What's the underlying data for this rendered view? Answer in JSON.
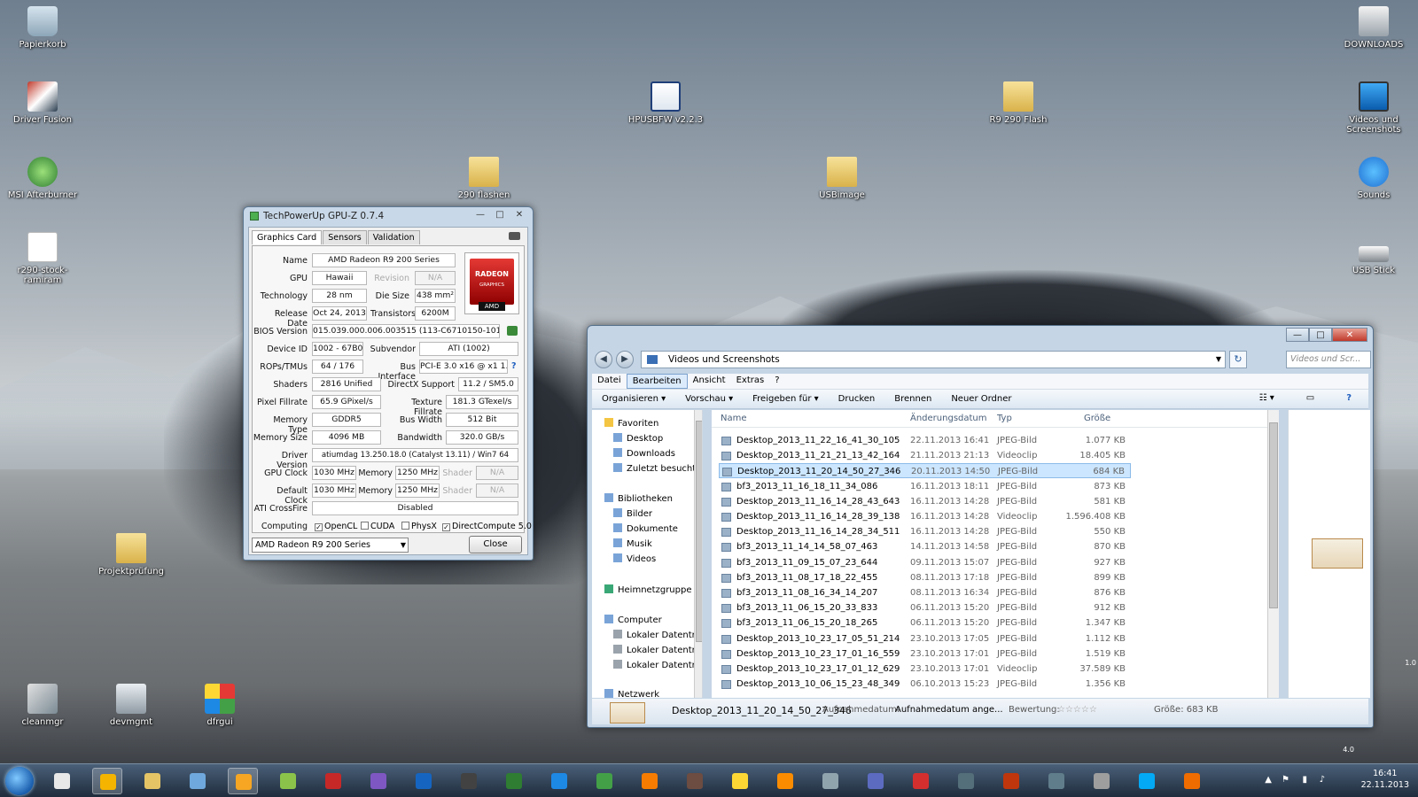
{
  "desktop": {
    "icons": [
      {
        "label": "Papierkorb",
        "icon": "recycle-bin-icon"
      },
      {
        "label": "Driver Fusion",
        "icon": "driver-fusion-icon"
      },
      {
        "label": "MSI Afterburner",
        "icon": "msi-afterburner-icon"
      },
      {
        "label": "r290-stock-ramiram",
        "icon": "document-icon"
      },
      {
        "label": "HPUSBFW v2.2.3",
        "icon": "window-app-icon"
      },
      {
        "label": "290 flashen",
        "icon": "folder-icon"
      },
      {
        "label": "R9 290 Flash",
        "icon": "folder-icon"
      },
      {
        "label": "USBimage",
        "icon": "folder-icon"
      },
      {
        "label": "DOWNLOADS",
        "icon": "drive-icon"
      },
      {
        "label": "Videos und Screenshots",
        "icon": "monitor-icon"
      },
      {
        "label": "Sounds",
        "icon": "music-note-icon"
      },
      {
        "label": "USB Stick",
        "icon": "usb-drive-icon"
      },
      {
        "label": "Projektprüfung",
        "icon": "folder-icon"
      },
      {
        "label": "cleanmgr",
        "icon": "cleanup-tool-icon"
      },
      {
        "label": "devmgmt",
        "icon": "device-manager-icon"
      },
      {
        "label": "dfrgui",
        "icon": "defrag-icon"
      }
    ],
    "side_labels": [
      "1.0",
      "4.0"
    ]
  },
  "gpuz": {
    "title": "TechPowerUp GPU-Z 0.7.4",
    "tabs": [
      "Graphics Card",
      "Sensors",
      "Validation"
    ],
    "logo": {
      "line1": "RADEON",
      "line2": "GRAPHICS",
      "brand": "AMD"
    },
    "name_label": "Name",
    "name": "AMD Radeon R9 200 Series",
    "gpu_label": "GPU",
    "gpu": "Hawaii",
    "revision_label": "Revision",
    "revision": "N/A",
    "technology_label": "Technology",
    "technology": "28 nm",
    "die_size_label": "Die Size",
    "die_size": "438 mm²",
    "release_date_label": "Release Date",
    "release_date": "Oct 24, 2013",
    "transistors_label": "Transistors",
    "transistors": "6200M",
    "bios_label": "BIOS Version",
    "bios": "015.039.000.006.003515 (113-C6710150-101)",
    "device_id_label": "Device ID",
    "device_id": "1002 - 67B0",
    "subvendor_label": "Subvendor",
    "subvendor": "ATI (1002)",
    "rops_label": "ROPs/TMUs",
    "rops": "64 / 176",
    "bus_label": "Bus Interface",
    "bus": "PCI-E 3.0 x16 @ x1 1.1",
    "bus_help": "?",
    "shaders_label": "Shaders",
    "shaders": "2816 Unified",
    "directx_label": "DirectX Support",
    "directx": "11.2 / SM5.0",
    "pixel_label": "Pixel Fillrate",
    "pixel": "65.9 GPixel/s",
    "texture_label": "Texture Fillrate",
    "texture": "181.3 GTexel/s",
    "memtype_label": "Memory Type",
    "memtype": "GDDR5",
    "buswidth_label": "Bus Width",
    "buswidth": "512 Bit",
    "memsize_label": "Memory Size",
    "memsize": "4096 MB",
    "bandwidth_label": "Bandwidth",
    "bandwidth": "320.0 GB/s",
    "driver_label": "Driver Version",
    "driver": "atiumdag 13.250.18.0 (Catalyst 13.11) / Win7 64",
    "gpuclock_label": "GPU Clock",
    "gpuclock": "1030 MHz",
    "memory_label": "Memory",
    "memclock": "1250 MHz",
    "shader_label": "Shader",
    "shader": "N/A",
    "defclock_label": "Default Clock",
    "defclock": "1030 MHz",
    "defmem": "1250 MHz",
    "defshader": "N/A",
    "crossfire_label": "ATI CrossFire",
    "crossfire": "Disabled",
    "computing_label": "Computing",
    "compute": [
      {
        "label": "OpenCL",
        "checked": "✓"
      },
      {
        "label": "CUDA",
        "checked": ""
      },
      {
        "label": "PhysX",
        "checked": ""
      },
      {
        "label": "DirectCompute 5.0",
        "checked": "✓"
      }
    ],
    "selected_gpu": "AMD Radeon R9 200 Series",
    "close_label": "Close"
  },
  "explorer": {
    "path": "Videos und Screenshots",
    "search_placeholder": "Videos und Scr...",
    "menu": [
      "Datei",
      "Bearbeiten",
      "Ansicht",
      "Extras",
      "?"
    ],
    "commands": [
      "Organisieren ▾",
      "Vorschau ▾",
      "Freigeben für ▾",
      "Drucken",
      "Brennen",
      "Neuer Ordner"
    ],
    "nav": {
      "favorites": "Favoriten",
      "fav_items": [
        "Desktop",
        "Downloads",
        "Zuletzt besucht"
      ],
      "libraries": "Bibliotheken",
      "lib_items": [
        "Bilder",
        "Dokumente",
        "Musik",
        "Videos"
      ],
      "homegroup": "Heimnetzgruppe",
      "computer": "Computer",
      "comp_items": [
        "Lokaler Datenträ",
        "Lokaler Datenträ",
        "Lokaler Datenträ"
      ],
      "network": "Netzwerk"
    },
    "columns": [
      "Name",
      "Änderungsdatum",
      "Typ",
      "Größe"
    ],
    "files": [
      {
        "name": "Desktop_2013_11_22_16_41_30_105",
        "date": "22.11.2013 16:41",
        "type": "JPEG-Bild",
        "size": "1.077 KB"
      },
      {
        "name": "Desktop_2013_11_21_21_13_42_164",
        "date": "21.11.2013 21:13",
        "type": "Videoclip",
        "size": "18.405 KB"
      },
      {
        "name": "Desktop_2013_11_20_14_50_27_346",
        "date": "20.11.2013 14:50",
        "type": "JPEG-Bild",
        "size": "684 KB"
      },
      {
        "name": "bf3_2013_11_16_18_11_34_086",
        "date": "16.11.2013 18:11",
        "type": "JPEG-Bild",
        "size": "873 KB"
      },
      {
        "name": "Desktop_2013_11_16_14_28_43_643",
        "date": "16.11.2013 14:28",
        "type": "JPEG-Bild",
        "size": "581 KB"
      },
      {
        "name": "Desktop_2013_11_16_14_28_39_138",
        "date": "16.11.2013 14:28",
        "type": "Videoclip",
        "size": "1.596.408 KB"
      },
      {
        "name": "Desktop_2013_11_16_14_28_34_511",
        "date": "16.11.2013 14:28",
        "type": "JPEG-Bild",
        "size": "550 KB"
      },
      {
        "name": "bf3_2013_11_14_14_58_07_463",
        "date": "14.11.2013 14:58",
        "type": "JPEG-Bild",
        "size": "870 KB"
      },
      {
        "name": "bf3_2013_11_09_15_07_23_644",
        "date": "09.11.2013 15:07",
        "type": "JPEG-Bild",
        "size": "927 KB"
      },
      {
        "name": "bf3_2013_11_08_17_18_22_455",
        "date": "08.11.2013 17:18",
        "type": "JPEG-Bild",
        "size": "899 KB"
      },
      {
        "name": "bf3_2013_11_08_16_34_14_207",
        "date": "08.11.2013 16:34",
        "type": "JPEG-Bild",
        "size": "876 KB"
      },
      {
        "name": "bf3_2013_11_06_15_20_33_833",
        "date": "06.11.2013 15:20",
        "type": "JPEG-Bild",
        "size": "912 KB"
      },
      {
        "name": "bf3_2013_11_06_15_20_18_265",
        "date": "06.11.2013 15:20",
        "type": "JPEG-Bild",
        "size": "1.347 KB"
      },
      {
        "name": "Desktop_2013_10_23_17_05_51_214",
        "date": "23.10.2013 17:05",
        "type": "JPEG-Bild",
        "size": "1.112 KB"
      },
      {
        "name": "Desktop_2013_10_23_17_01_16_559",
        "date": "23.10.2013 17:01",
        "type": "JPEG-Bild",
        "size": "1.519 KB"
      },
      {
        "name": "Desktop_2013_10_23_17_01_12_629",
        "date": "23.10.2013 17:01",
        "type": "Videoclip",
        "size": "37.589 KB"
      },
      {
        "name": "Desktop_2013_10_06_15_23_48_349",
        "date": "06.10.2013 15:23",
        "type": "JPEG-Bild",
        "size": "1.356 KB"
      }
    ],
    "details": {
      "filename": "Desktop_2013_11_20_14_50_27_346",
      "date_label": "Aufnahmedatum:",
      "date_value": "Aufnahmedatum ange...",
      "rating_label": "Bewertung:",
      "stars": "☆☆☆☆☆",
      "size_label": "Größe: 683 KB"
    }
  },
  "taskbar": {
    "apps": [
      "start-orb-icon",
      "chrome-icon",
      "explorer-icon",
      "mail-icon",
      "media-player-icon",
      "monitor-app-icon",
      "driver-fusion-icon",
      "cpu-z-icon",
      "benchmark-icon",
      "bf3-icon",
      "msi-afterburner-icon",
      "wordpad-icon",
      "green-app-icon",
      "origin-icon",
      "game-icon",
      "steam-app-icon",
      "yellow-app-icon",
      "cleaner-icon",
      "network-icon",
      "paint-icon",
      "red-app-icon",
      "steam-icon",
      "gimp-icon",
      "device-manager-icon",
      "disk-icon",
      "skype-icon",
      "orange-app-icon"
    ],
    "time": "16:41",
    "date": "22.11.2013"
  }
}
